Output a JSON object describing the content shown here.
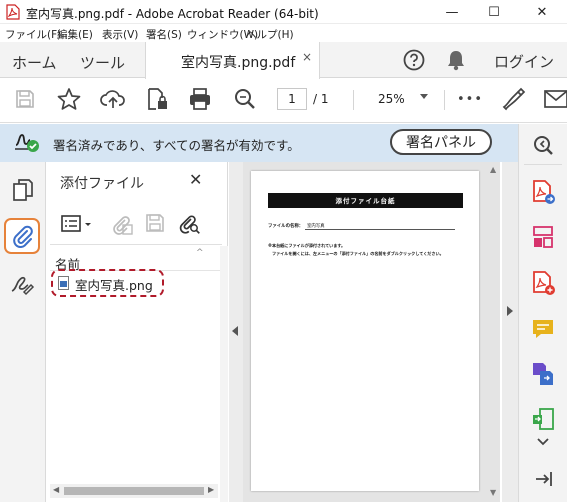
{
  "window": {
    "title": "室内写真.png.pdf - Adobe Acrobat Reader (64-bit)",
    "controls": {
      "minimize": "—",
      "maximize": "☐",
      "close": "✕"
    }
  },
  "menu": [
    "ファイル(F)",
    "編集(E)",
    "表示(V)",
    "署名(S)",
    "ウィンドウ(W)",
    "ヘルプ(H)"
  ],
  "tabs": {
    "home": "ホーム",
    "tools": "ツール",
    "document": "室内写真.png.pdf",
    "document_close": "×"
  },
  "header": {
    "login": "ログイン"
  },
  "toolbar": {
    "page_current": "1",
    "page_total": "/ 1",
    "zoom": "25%",
    "more": "•••"
  },
  "signature_banner": {
    "message": "署名済みであり、すべての署名が有効です。",
    "panel_button": "署名パネル"
  },
  "attachments_panel": {
    "title": "添付ファイル",
    "close": "✕",
    "column_header": "名前",
    "sort_indicator": "^",
    "files": [
      {
        "name": "室内写真.png"
      }
    ],
    "scroll_left": "◀",
    "scroll_right": "▶"
  },
  "document_page": {
    "heading": "添付ファイル台紙",
    "field_label": "ファイルの名称：",
    "field_value": "室内写真",
    "line1": "※本台紙にファイルが添付されています。",
    "line2": "ファイルを開くには、左メニューの「添付ファイル」の名前をダブルクリックしてください。"
  },
  "scrollbar": {
    "up": "▲",
    "down": "▼"
  },
  "colors": {
    "banner_bg": "#d6e5f3",
    "highlight_orange": "#e6823a",
    "annotation_red": "#b11a2a",
    "brand_red": "#e03c31",
    "blue": "#3c6fc9",
    "pink": "#d6336c",
    "yellow": "#e7b21b",
    "purple": "#6a4cc9",
    "green": "#3aa64a"
  },
  "icons": {
    "app": "acrobat-pdf-icon",
    "help": "help-circle-icon",
    "notifications": "bell-icon",
    "save": "save-icon",
    "bookmark": "star-icon",
    "share": "upload-cloud-icon",
    "protect": "file-lock-icon",
    "print": "printer-icon",
    "find": "magnifier-icon",
    "sign": "pen-icon",
    "mail": "envelope-icon"
  }
}
